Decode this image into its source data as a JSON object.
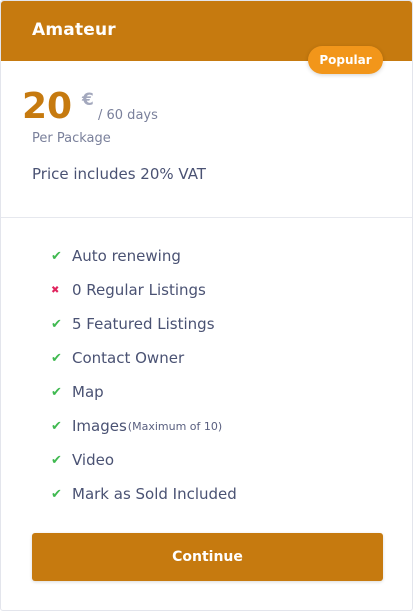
{
  "plan": {
    "title": "Amateur",
    "badge": "Popular",
    "price": "20",
    "currency": "€",
    "period": "/ 60 days",
    "per_package": "Per Package",
    "vat_note": "Price includes 20% VAT"
  },
  "features": [
    {
      "label": "Auto renewing",
      "note": "",
      "included": true,
      "icon": "check-icon"
    },
    {
      "label": "0 Regular Listings",
      "note": "",
      "included": false,
      "icon": "cross-icon"
    },
    {
      "label": "5 Featured Listings",
      "note": "",
      "included": true,
      "icon": "check-icon"
    },
    {
      "label": "Contact Owner",
      "note": "",
      "included": true,
      "icon": "check-icon"
    },
    {
      "label": "Map",
      "note": "",
      "included": true,
      "icon": "check-icon"
    },
    {
      "label": "Images",
      "note": "(Maximum of 10)",
      "included": true,
      "icon": "check-icon"
    },
    {
      "label": "Video",
      "note": "",
      "included": true,
      "icon": "check-icon"
    },
    {
      "label": "Mark as Sold Included",
      "note": "",
      "included": true,
      "icon": "check-icon"
    }
  ],
  "actions": {
    "continue_label": "Continue"
  },
  "colors": {
    "accent": "#c67a0f",
    "badge": "#f2961a",
    "check": "#3fb950",
    "cross": "#e0245e"
  }
}
